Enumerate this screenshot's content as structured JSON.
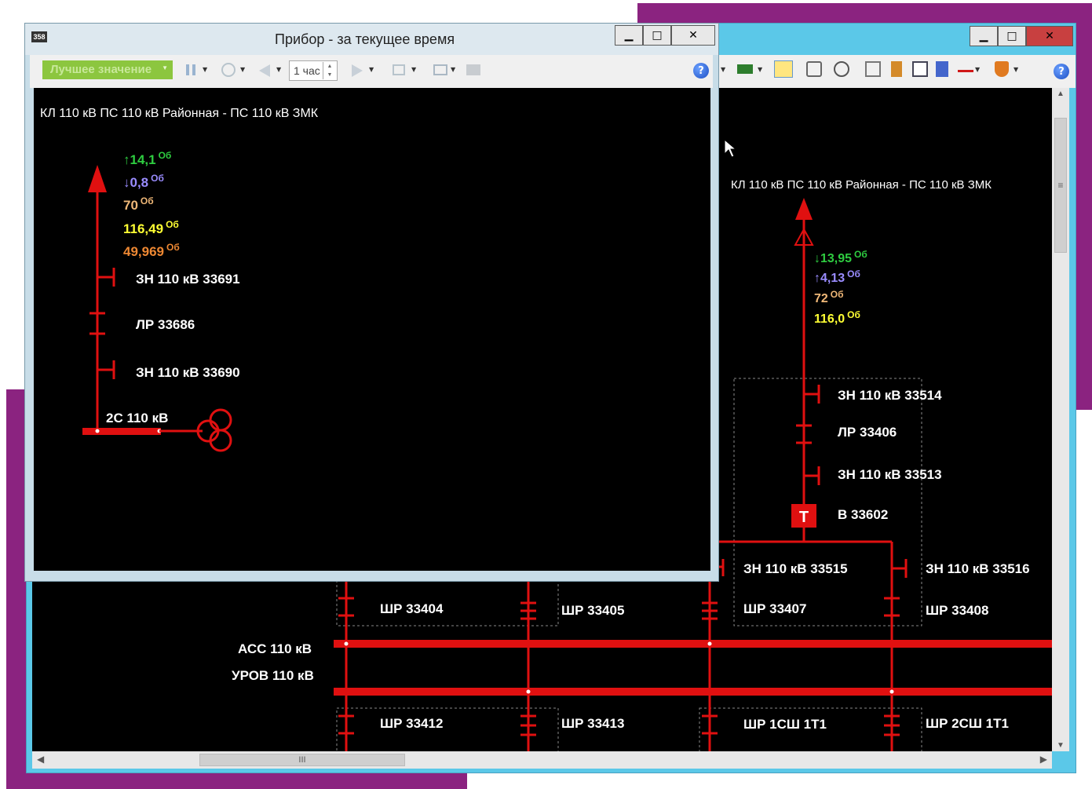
{
  "back_window": {
    "title_bar_buttons": [
      "minimize",
      "maximize",
      "close"
    ],
    "scheme_title": "КЛ 110 кВ ПС 110 кВ Районная - ПС 110 кВ ЗМК",
    "measurements": [
      {
        "arrow": "↓",
        "value": "13,95",
        "unit": "Об",
        "color": "#2ecc40"
      },
      {
        "arrow": "↑",
        "value": "4,13",
        "unit": "Об",
        "color": "#9a8cff"
      },
      {
        "arrow": "",
        "value": "72",
        "unit": "Об",
        "color": "#f0b878"
      },
      {
        "arrow": "",
        "value": "116,0",
        "unit": "Об",
        "color": "#ffff33"
      }
    ],
    "labels": {
      "zn_33514": "ЗН 110 кВ 33514",
      "lr_33406": "ЛР 33406",
      "zn_33513": "ЗН 110 кВ 33513",
      "v_33602": "В 33602",
      "breaker_letter": "Т",
      "zn_33515": "ЗН 110 кВ 33515",
      "zn_33516": "ЗН 110 кВ 33516",
      "shr_33404": "ШР 33404",
      "shr_33405": "ШР 33405",
      "shr_33407": "ШР 33407",
      "shr_33408": "ШР 33408",
      "bus_ass": "АСС 110 кВ",
      "bus_urov": "УРОВ 110 кВ",
      "shr_33412": "ШР 33412",
      "shr_33413": "ШР 33413",
      "shr_1sh": "ШР 1СШ 1Т1",
      "shr_2sh": "ШР 2СШ 1Т1"
    },
    "scroll_grip": "III",
    "toolbar_icons": [
      "cursor-icon",
      "monitor-icon",
      "note-icon",
      "find-icon",
      "compass-icon",
      "phone-icon",
      "tree-icon",
      "calendar-icon",
      "list-icon",
      "pen-icon",
      "shield-icon"
    ]
  },
  "front_window": {
    "app_icon_text": "358",
    "title": "Прибор - за текущее время",
    "toolbar": {
      "best_value_label": "Лучшее значение",
      "period_value": "1 час"
    },
    "scheme_title": "КЛ 110 кВ ПС 110 кВ Районная - ПС 110 кВ ЗМК",
    "measurements": [
      {
        "arrow": "↑",
        "value": "14,1",
        "unit": "Об",
        "color": "#2ecc40"
      },
      {
        "arrow": "↓",
        "value": "0,8",
        "unit": "Об",
        "color": "#9a8cff"
      },
      {
        "arrow": "",
        "value": "70",
        "unit": "Об",
        "color": "#f0b878"
      },
      {
        "arrow": "",
        "value": "116,49",
        "unit": "Об",
        "color": "#ffff33"
      },
      {
        "arrow": "",
        "value": "49,969",
        "unit": "Об",
        "color": "#ee8833"
      }
    ],
    "labels": {
      "zn_33691": "ЗН 110 кВ 33691",
      "lr_33686": "ЛР 33686",
      "zn_33690": "ЗН 110 кВ 33690",
      "bus_2s": "2С 110 кВ"
    }
  },
  "colors": {
    "scheme_red": "#e01010",
    "accent_purple": "#8b2380",
    "titlebar_cyan": "#5bc8e8",
    "best_value_green": "#8cc63f"
  }
}
